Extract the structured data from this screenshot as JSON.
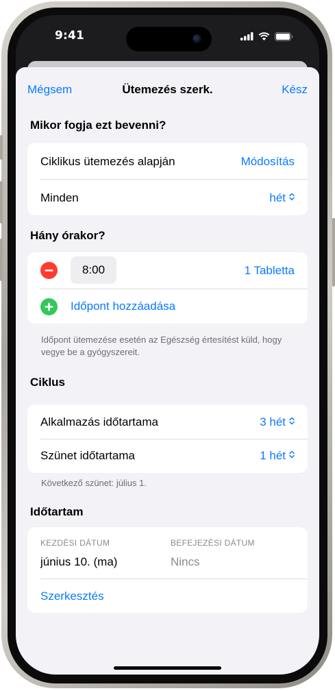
{
  "status_bar": {
    "time": "9:41"
  },
  "nav": {
    "cancel_label": "Mégsem",
    "title": "Ütemezés szerk.",
    "done_label": "Kész"
  },
  "section_when": {
    "title": "Mikor fogja ezt bevenni?",
    "cyclic_label": "Ciklikus ütemezés alapján",
    "modify_label": "Módosítás",
    "every_label": "Minden",
    "every_value": "hét"
  },
  "section_times": {
    "title": "Hány órakor?",
    "time_value": "8:00",
    "dose_value": "1 Tabletta",
    "add_time_label": "Időpont hozzáadása",
    "footnote": "Időpont ütemezése esetén az Egészség értesítést küld, hogy vegye be a gyógyszereit."
  },
  "section_cycle": {
    "title": "Ciklus",
    "duration_label": "Alkalmazás időtartama",
    "duration_value": "3 hét",
    "break_label": "Szünet időtartama",
    "break_value": "1 hét",
    "footnote": "Következő szünet: július 1."
  },
  "section_duration": {
    "title": "Időtartam",
    "start_header": "KEZDÉSI DÁTUM",
    "start_value": "június 10. (ma)",
    "end_header": "BEFEJEZÉSI DÁTUM",
    "end_value": "Nincs",
    "edit_label": "Szerkesztés"
  },
  "colors": {
    "accent": "#0a7aff",
    "destructive": "#ff3b30",
    "add_green": "#34c759",
    "sheet_background": "#f2f2f7"
  }
}
